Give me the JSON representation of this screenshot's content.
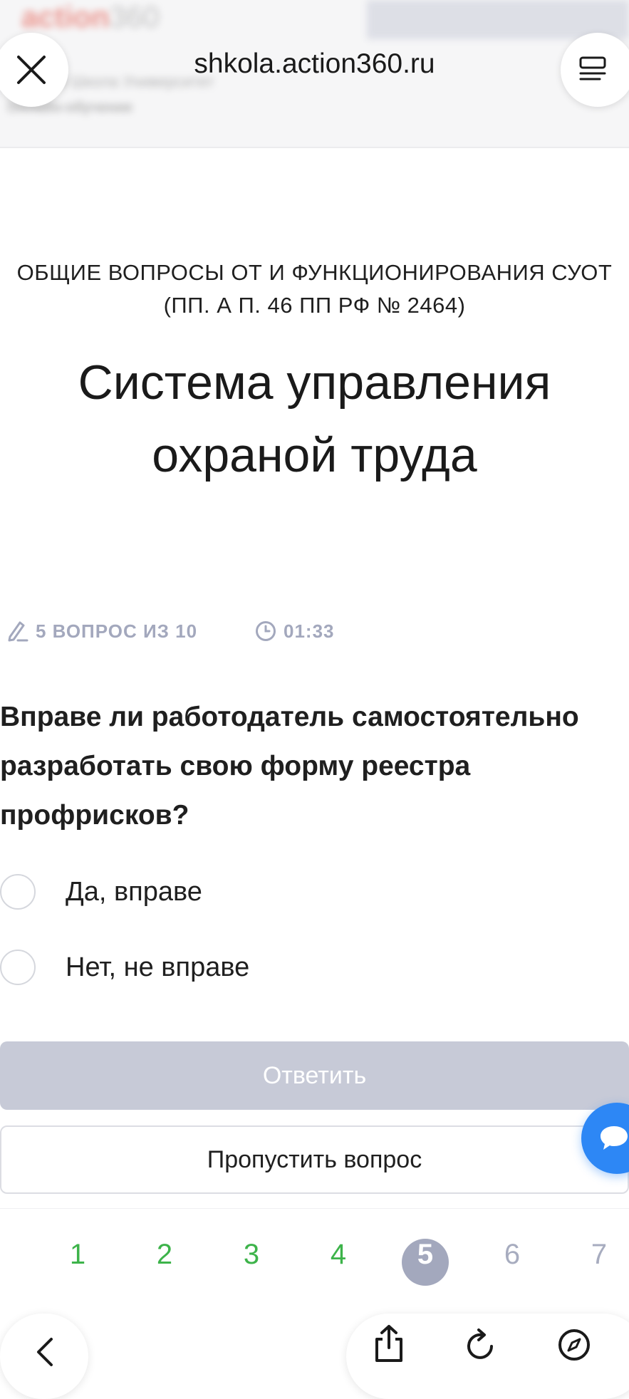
{
  "site_header": {
    "logo_main": "action",
    "logo_suffix": "360",
    "sub_title": "Высшая Школа Университет",
    "sub_caption": "Онлайн-обучение"
  },
  "browser": {
    "url": "shkola.action360.ru"
  },
  "course": {
    "category": "ОБЩИЕ ВОПРОСЫ ОТ И ФУНКЦИОНИРОВАНИЯ СУОТ (ПП. А П. 46 ПП РФ № 2464)",
    "title": "Система управления охраной труда"
  },
  "quiz": {
    "progress_label": "5 ВОПРОС ИЗ 10",
    "timer": "01:33",
    "question": "Вправе ли работодатель самостоятельно разработать свою форму реестра профрисков?",
    "options": [
      {
        "label": "Да, вправе",
        "selected": false
      },
      {
        "label": "Нет, не вправе",
        "selected": false
      }
    ],
    "answer_button": "Ответить",
    "skip_button": "Пропустить вопрос"
  },
  "pager": {
    "pages": [
      "1",
      "2",
      "3",
      "4",
      "5",
      "6",
      "7"
    ],
    "current": 5,
    "answered": [
      1,
      2,
      3,
      4
    ]
  },
  "colors": {
    "accent_blue": "#2d87f5",
    "done_green": "#3db34a",
    "muted": "#a3a8bd",
    "button_disabled": "#c7cad7"
  }
}
